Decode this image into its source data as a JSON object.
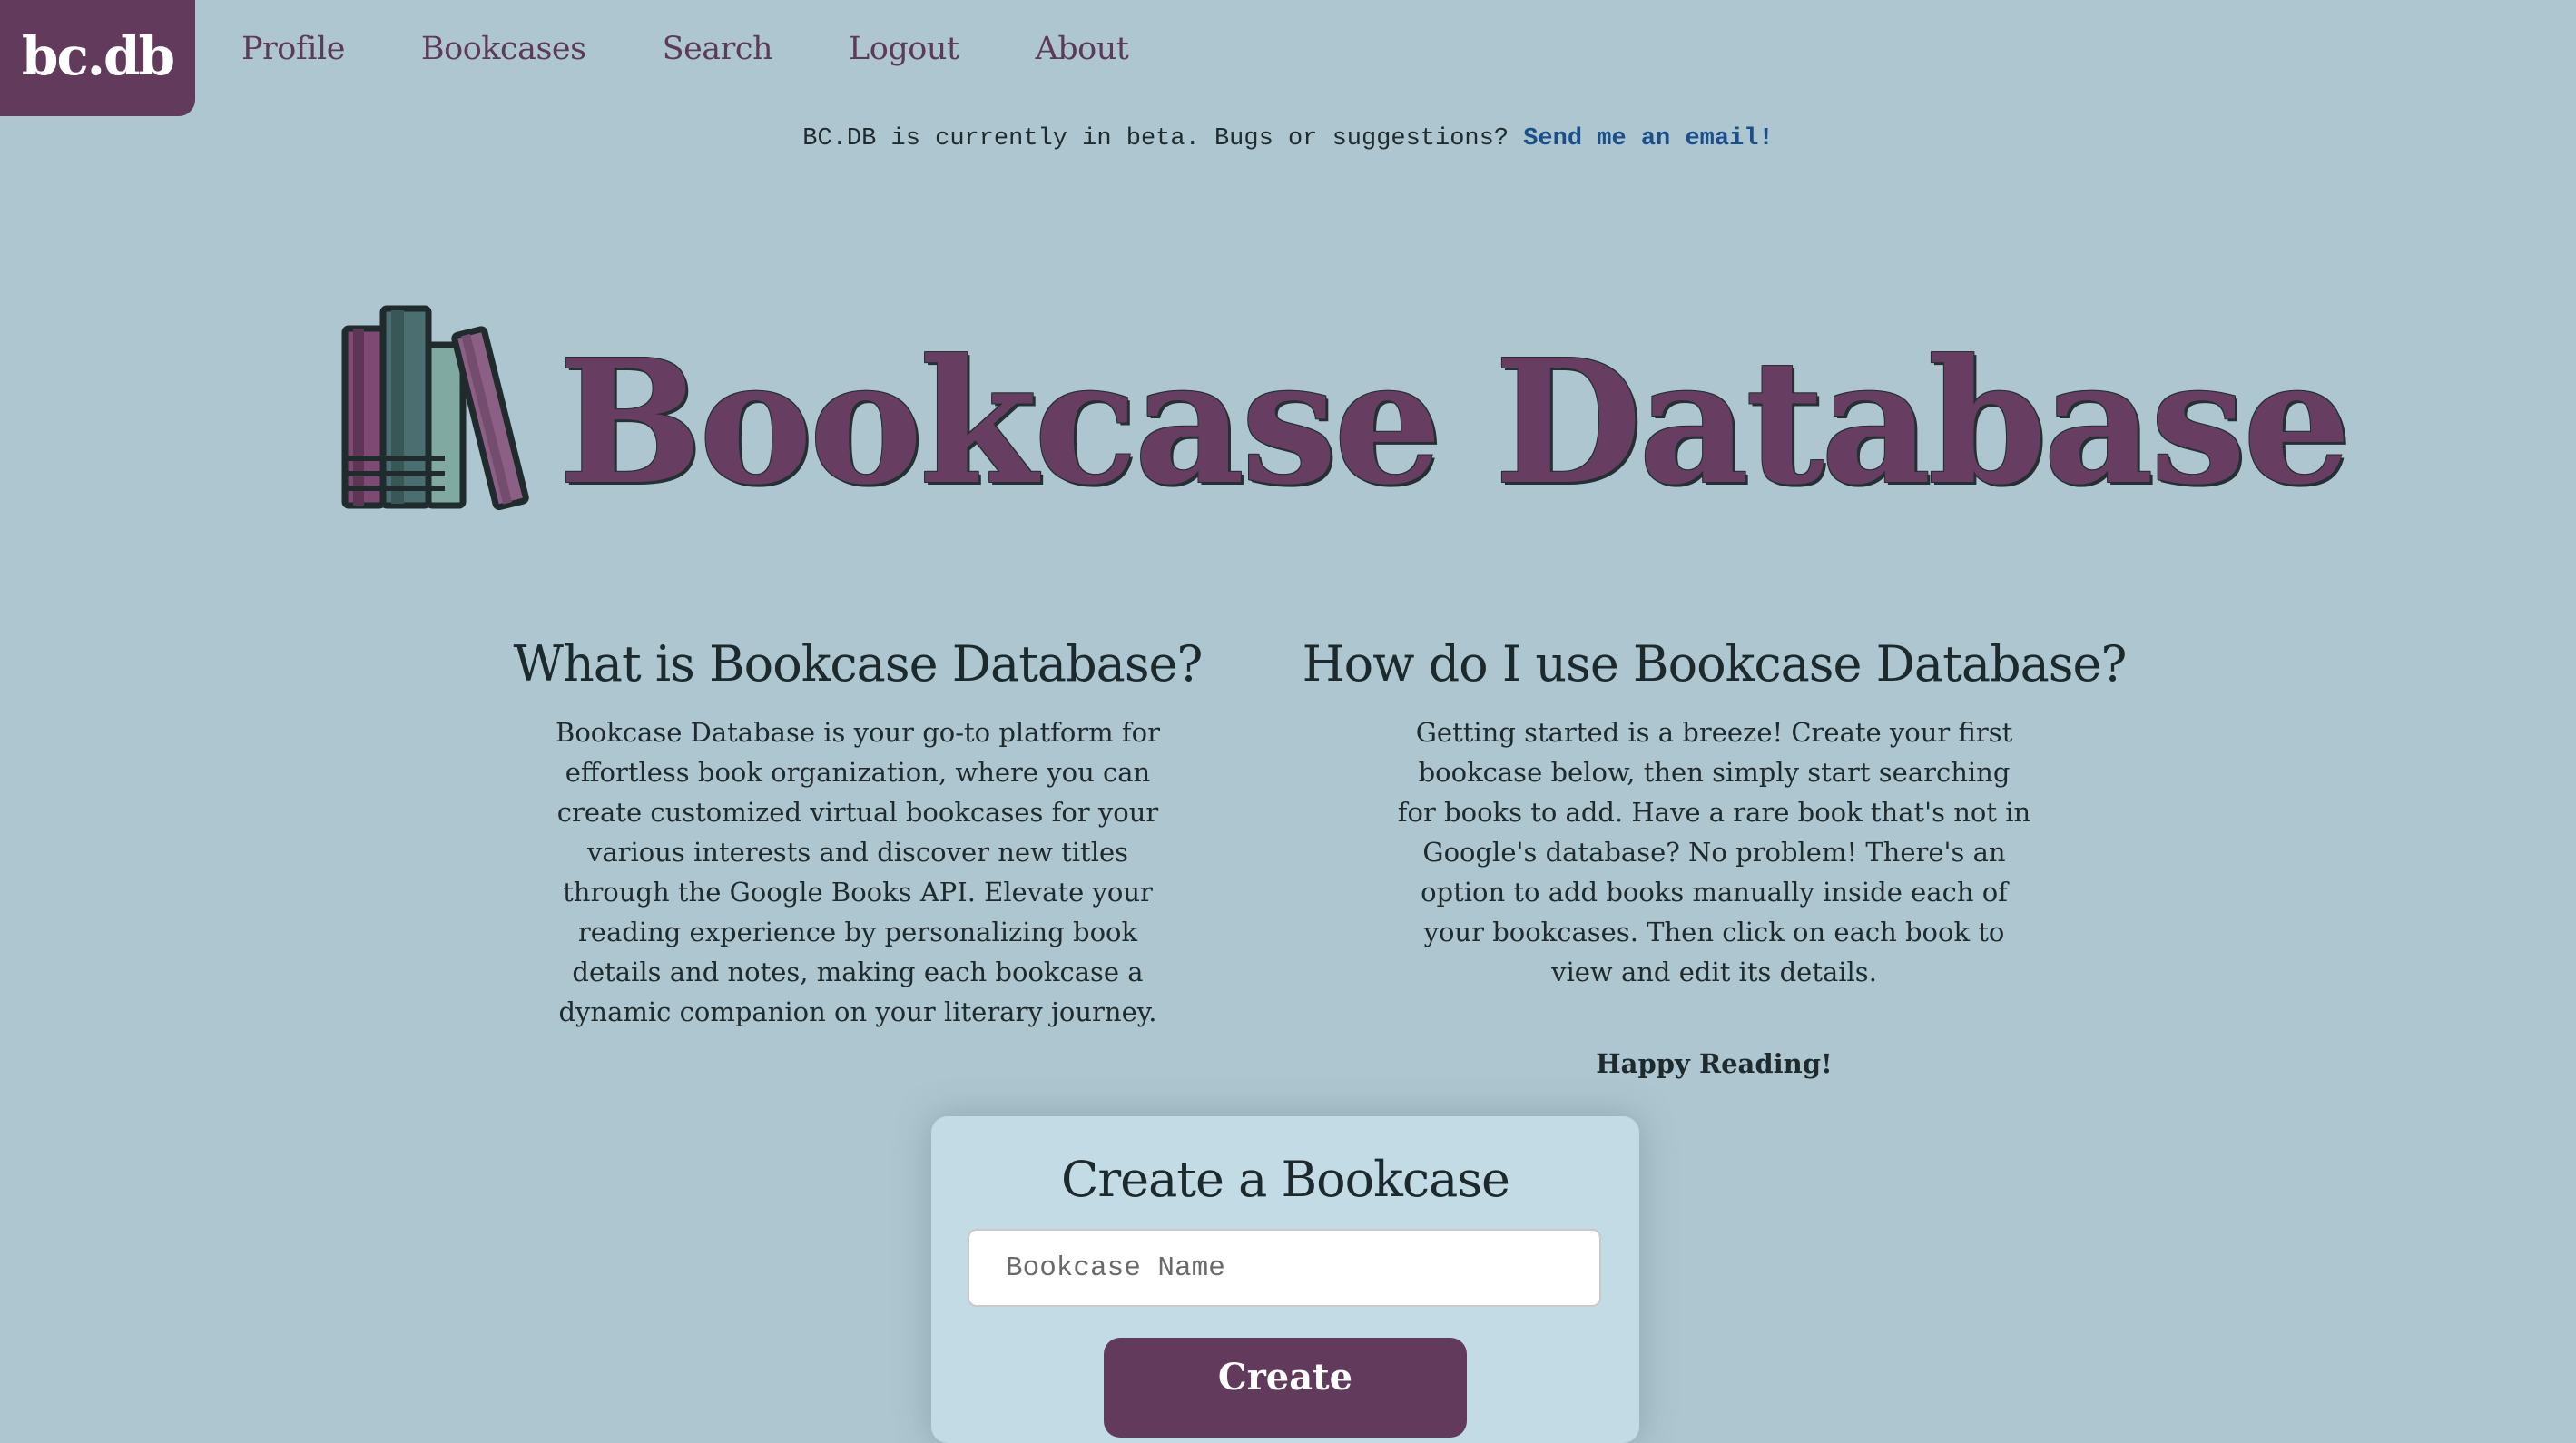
{
  "brand": {
    "logo_text": "bc.db"
  },
  "nav": {
    "items": [
      "Profile",
      "Bookcases",
      "Search",
      "Logout",
      "About"
    ]
  },
  "beta_banner": {
    "text": "BC.DB is currently in beta. Bugs or suggestions?",
    "link_text": "Send me an email!",
    "link_color": "#1b4f8a"
  },
  "hero": {
    "icon": "books-icon",
    "title": "Bookcase Database"
  },
  "what": {
    "heading": "What is Bookcase Database?",
    "body": "Bookcase Database is your go-to platform for effortless book organization, where you can create customized virtual bookcases for your various interests and discover new titles through the Google Books API. Elevate your reading experience by personalizing book details and notes, making each bookcase a dynamic companion on your literary journey."
  },
  "how": {
    "heading": "How do I use Bookcase Database?",
    "body": "Getting started is a breeze! Create your first bookcase below, then simply start searching for books to add. Have a rare book that's not in Google's database? No problem! There's an option to add books manually inside each of your bookcases. Then click on each book to view and edit its details.",
    "closing": "Happy Reading!"
  },
  "create": {
    "heading": "Create a Bookcase",
    "input_placeholder": "Bookcase Name",
    "input_value": "",
    "button_label": "Create"
  },
  "colors": {
    "background": "#aec6d0",
    "brand": "#613a5c",
    "card": "#c3dbe4"
  }
}
